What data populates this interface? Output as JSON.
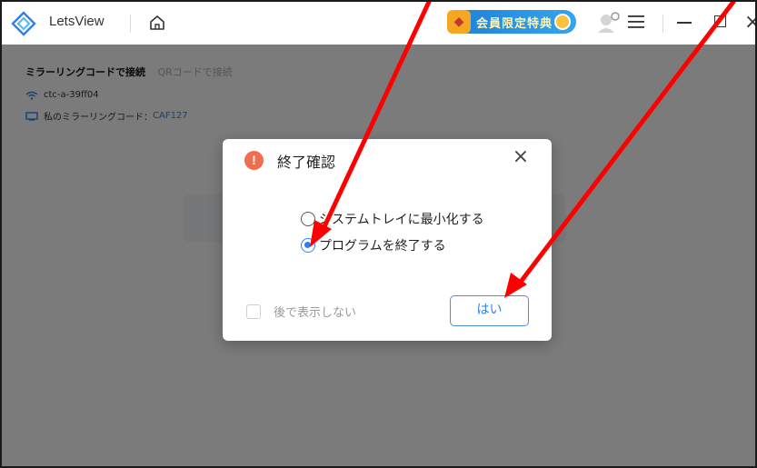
{
  "window": {
    "app_name": "LetsView",
    "promo_label": "会員限定特典",
    "controls": {
      "minimize": "—",
      "maximize": "",
      "close": "×"
    }
  },
  "background": {
    "tabs": [
      "ミラーリングコードで接続",
      "QRコードで接続"
    ],
    "wifi_name": "ctc-a-39ff04",
    "mirror_code_label": "私のミラーリングコード：",
    "mirror_code": "CAF127"
  },
  "dialog": {
    "title": "終了確認",
    "warn_glyph": "!",
    "close": "×",
    "options": [
      {
        "label": "システムトレイに最小化する",
        "checked": false
      },
      {
        "label": "プログラムを終了する",
        "checked": true
      }
    ],
    "dont_show_label": "後で表示しない",
    "confirm_label": "はい"
  },
  "annotation": {
    "arrow_color": "#ff0000",
    "count": 2
  },
  "colors": {
    "accent": "#2f80ed",
    "warning": "#f26c4f",
    "overlay": "rgba(0,0,0,0.5)"
  }
}
